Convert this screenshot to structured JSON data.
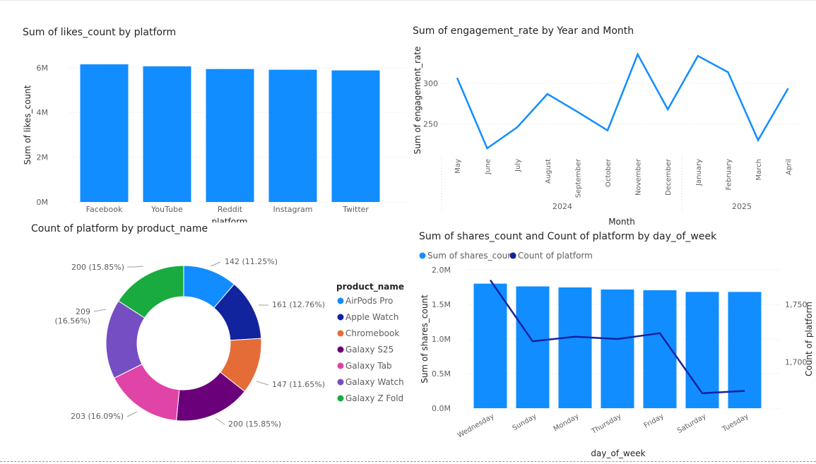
{
  "colors": {
    "bar": "#118DFF",
    "line": "#118DFF",
    "line_dark": "#12239E",
    "grid": "#dddddd",
    "axis_text": "#605E5C",
    "title_text": "#252423",
    "donut": [
      "#118DFF",
      "#12239E",
      "#E66C37",
      "#6B007B",
      "#E044A7",
      "#744EC2",
      "#1AAB40"
    ]
  },
  "charts": {
    "likes": {
      "title": "Sum of likes_count by platform",
      "xlabel": "platform",
      "ylabel": "Sum of likes_count",
      "yticks": [
        "0M",
        "2M",
        "4M",
        "6M"
      ]
    },
    "engagement": {
      "title": "Sum of engagement_rate by Year and Month",
      "xlabel": "Month",
      "ylabel": "Sum of engagement_rate",
      "yticks": [
        "250",
        "300"
      ],
      "years": [
        "2024",
        "2025"
      ]
    },
    "donut": {
      "title": "Count of platform by product_name",
      "legend_title": "product_name",
      "data_labels": [
        "142 (11.25%)",
        "161 (12.76%)",
        "147 (11.65%)",
        "200 (15.85%)",
        "203 (16.09%)",
        "209",
        "(16.56%)",
        "200 (15.85%)"
      ]
    },
    "shares": {
      "title": "Sum of shares_count and Count of platform by day_of_week",
      "xlabel": "day_of_week",
      "ylabel_left": "Sum of shares_count",
      "ylabel_right": "Count of platform",
      "legend": [
        "Sum of shares_count",
        "Count of platform"
      ],
      "yticks_left": [
        "0.0M",
        "0.5M",
        "1.0M",
        "1.5M",
        "2.0M"
      ],
      "yticks_right": [
        "1,700",
        "1,750"
      ]
    }
  },
  "chart_data": [
    {
      "type": "bar",
      "title": "Sum of likes_count by platform",
      "xlabel": "platform",
      "ylabel": "Sum of likes_count",
      "categories": [
        "Facebook",
        "YouTube",
        "Reddit",
        "Instagram",
        "Twitter"
      ],
      "values": [
        6150000,
        6060000,
        5940000,
        5910000,
        5880000
      ],
      "ylim": [
        0,
        6500000
      ],
      "grid": true
    },
    {
      "type": "line",
      "title": "Sum of engagement_rate by Year and Month",
      "xlabel": "Month",
      "ylabel": "Sum of engagement_rate",
      "x": [
        "May",
        "June",
        "July",
        "August",
        "September",
        "October",
        "November",
        "December",
        "January",
        "February",
        "March",
        "April"
      ],
      "year_groups": [
        {
          "year": "2024",
          "months": 8
        },
        {
          "year": "2025",
          "months": 4
        }
      ],
      "values": [
        307,
        220,
        246,
        287,
        265,
        242,
        336,
        268,
        334,
        314,
        230,
        294
      ],
      "ylim": [
        213,
        342
      ],
      "grid": true
    },
    {
      "type": "pie",
      "title": "Count of platform by product_name",
      "categories": [
        "AirPods Pro",
        "Apple Watch",
        "Chromebook",
        "Galaxy S25",
        "Galaxy Tab",
        "Galaxy Watch",
        "Galaxy Z Fold"
      ],
      "values": [
        142,
        161,
        147,
        200,
        203,
        209,
        200
      ],
      "percent": [
        11.25,
        12.76,
        11.65,
        15.85,
        16.09,
        16.56,
        15.85
      ],
      "legend_position": "right"
    },
    {
      "type": "bar",
      "title": "Sum of shares_count and Count of platform by day_of_week",
      "xlabel": "day_of_week",
      "categories": [
        "Wednesday",
        "Sunday",
        "Monday",
        "Thursday",
        "Friday",
        "Saturday",
        "Tuesday"
      ],
      "series": [
        {
          "name": "Sum of shares_count",
          "type": "bar",
          "axis": "left",
          "values": [
            1800000,
            1760000,
            1745000,
            1715000,
            1705000,
            1680000,
            1680000
          ]
        },
        {
          "name": "Count of platform",
          "type": "line",
          "axis": "right",
          "values": [
            1771,
            1718,
            1722,
            1720,
            1725,
            1673,
            1675
          ]
        }
      ],
      "ylim_left": [
        0,
        2000000
      ],
      "ylim_right": [
        1660,
        1780
      ],
      "legend_position": "top-left",
      "grid": true
    }
  ]
}
